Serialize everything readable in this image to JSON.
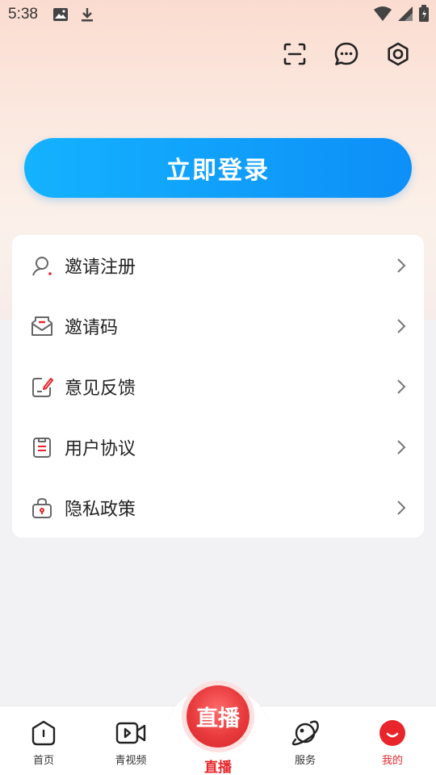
{
  "status_bar": {
    "time": "5:38",
    "icons": [
      "image-icon",
      "download-icon",
      "wifi-icon",
      "signal-icon",
      "battery-icon"
    ]
  },
  "top_actions": [
    "scan-icon",
    "message-icon",
    "settings-icon"
  ],
  "login": {
    "label": "立即登录"
  },
  "menu": {
    "items": [
      {
        "label": "邀请注册",
        "icon": "user-search-icon"
      },
      {
        "label": "邀请码",
        "icon": "mail-icon"
      },
      {
        "label": "意见反馈",
        "icon": "feedback-edit-icon"
      },
      {
        "label": "用户协议",
        "icon": "document-icon"
      },
      {
        "label": "隐私政策",
        "icon": "lock-bag-icon"
      }
    ]
  },
  "bottom_nav": {
    "items": [
      {
        "label": "首页",
        "icon": "home-icon",
        "active": false
      },
      {
        "label": "青视频",
        "icon": "video-icon",
        "active": false
      },
      {
        "label": "直播",
        "icon": "live-icon",
        "badge": "直播",
        "active": false
      },
      {
        "label": "服务",
        "icon": "planet-icon",
        "active": false
      },
      {
        "label": "我的",
        "icon": "profile-icon",
        "active": true
      }
    ]
  },
  "colors": {
    "accent_blue": "#0d8ff7",
    "accent_red": "#e8252a",
    "icon_red": "#e8252a"
  }
}
